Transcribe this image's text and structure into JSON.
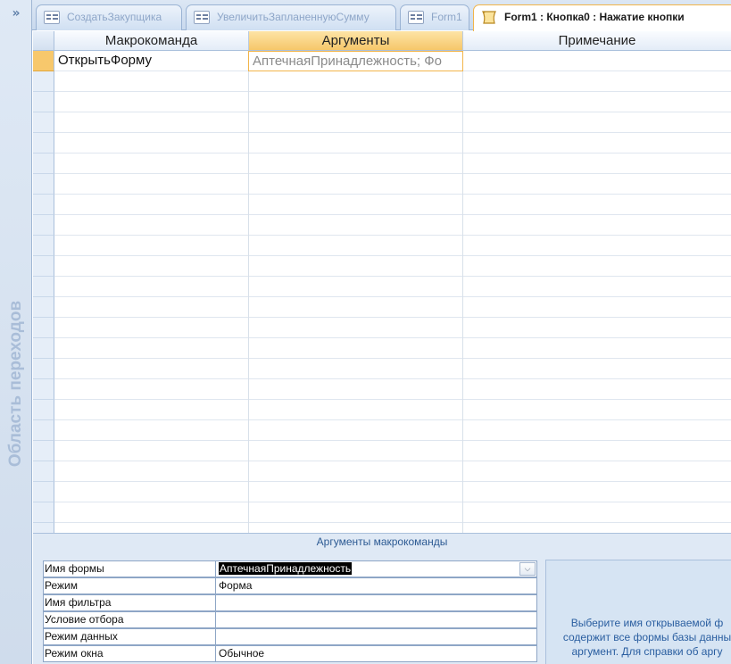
{
  "navigation_pane": {
    "toggle_glyph": "»",
    "caption": "Область переходов"
  },
  "tabs": [
    {
      "label": "СоздатьЗакупщика",
      "active": false,
      "icon": "form-icon"
    },
    {
      "label": "УвеличитьЗапланеннуюСумму",
      "active": false,
      "icon": "form-icon"
    },
    {
      "label": "Form1",
      "active": false,
      "icon": "form-icon"
    },
    {
      "label": "Form1 : Кнопка0 : Нажатие кнопки",
      "active": true,
      "icon": "macro-scroll-icon"
    }
  ],
  "grid": {
    "columns": [
      "Макрокоманда",
      "Аргументы",
      "Примечание"
    ],
    "rows": [
      {
        "action": "ОткрытьФорму",
        "arguments": "АптечнаяПринадлежность; Фо",
        "comment": ""
      }
    ]
  },
  "arguments_panel": {
    "title": "Аргументы макрокоманды",
    "properties": [
      {
        "label": "Имя формы",
        "value": "АптечнаяПринадлежность",
        "selected": true,
        "dropdown": true
      },
      {
        "label": "Режим",
        "value": "Форма"
      },
      {
        "label": "Имя фильтра",
        "value": ""
      },
      {
        "label": "Условие отбора",
        "value": ""
      },
      {
        "label": "Режим данных",
        "value": ""
      },
      {
        "label": "Режим окна",
        "value": "Обычное"
      }
    ],
    "help_lines": [
      "Выберите имя открываемой ф",
      "содержит все формы базы данны",
      "аргумент. Для справки об аргу"
    ]
  },
  "colors": {
    "accent": "#f6c76a",
    "chrome": "#dfe9f5",
    "help_text": "#2a5ea0"
  }
}
